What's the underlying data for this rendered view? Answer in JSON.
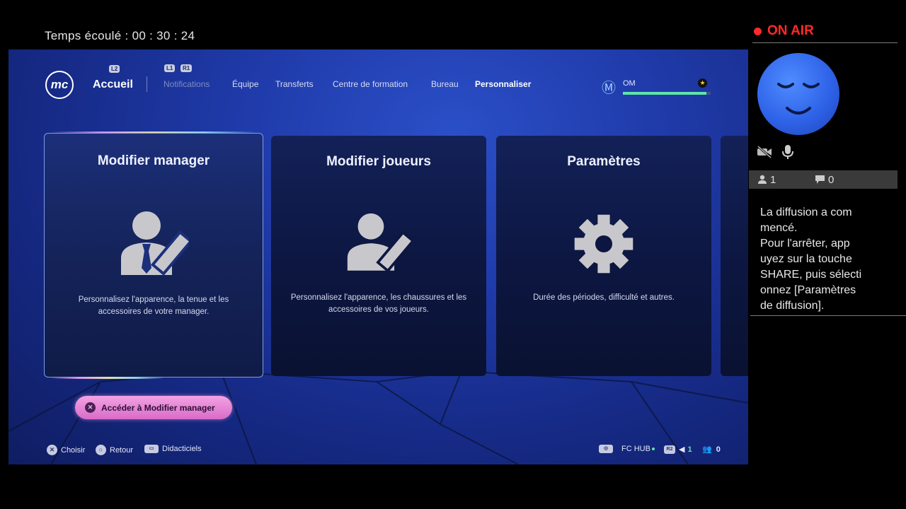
{
  "stream": {
    "timer_label": "Temps écoulé",
    "timer_value": "00 : 30 : 24",
    "on_air_label": "ON AIR",
    "viewers": "1",
    "comments": "0",
    "message_lines": [
      "La diffusion a com",
      "mencé.",
      "Pour l'arrêter, app",
      "uyez sur la touche",
      "SHARE, puis sélecti",
      "onnez [Paramètres",
      "de diffusion]."
    ]
  },
  "game": {
    "logo_text": "mc",
    "nav": {
      "hint_l2": "L2",
      "hint_l1": "L1",
      "hint_r1": "R1",
      "home": "Accueil",
      "items": [
        "Notifications",
        "Équipe",
        "Transferts",
        "Centre de formation",
        "Bureau",
        "Personnaliser"
      ],
      "active_index": 5
    },
    "club": {
      "name": "OM",
      "progress": 0.95
    },
    "cards": [
      {
        "title": "Modifier manager",
        "desc": "Personnalisez l'apparence, la tenue et les accessoires de votre manager.",
        "icon": "manager-edit-icon"
      },
      {
        "title": "Modifier joueurs",
        "desc": "Personnalisez l'apparence, les chaussures et les accessoires de vos joueurs.",
        "icon": "player-edit-icon"
      },
      {
        "title": "Paramètres",
        "desc": "Durée des périodes, difficulté et autres.",
        "icon": "gear-icon"
      }
    ],
    "action_button": "Accéder à Modifier manager",
    "footer": {
      "choose": "Choisir",
      "back": "Retour",
      "tutorials": "Didacticiels",
      "hub": "FC HUB",
      "notif_count": "1",
      "friends_count": "0"
    }
  },
  "colors": {
    "on_air": "#ff2a2a",
    "accent_green": "#5ee6a8",
    "action_pink": "#e27fd2"
  }
}
